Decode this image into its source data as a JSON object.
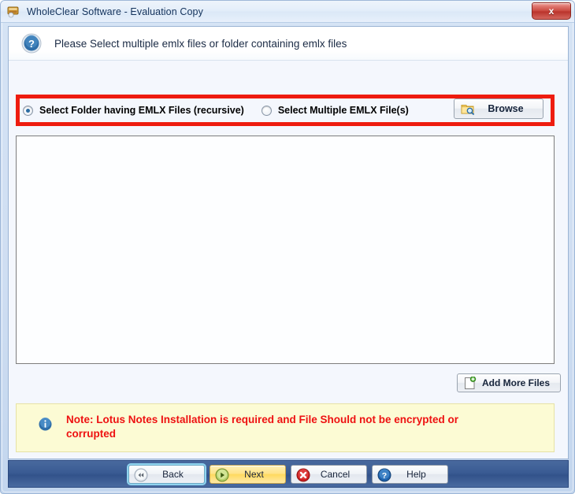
{
  "window": {
    "title": "WholeClear Software - Evaluation Copy",
    "app_icon": "app-icon",
    "close_label": "x"
  },
  "header": {
    "icon": "question-icon",
    "instruction": "Please Select multiple emlx files or folder containing emlx files"
  },
  "options": {
    "folder_option": {
      "label": "Select Folder having EMLX Files (recursive)",
      "selected": true
    },
    "files_option": {
      "label": "Select Multiple EMLX File(s)",
      "selected": false
    },
    "browse_button": {
      "label": "Browse",
      "icon": "folder-search-icon"
    }
  },
  "file_list": {
    "items": []
  },
  "add_more": {
    "label": "Add More Files",
    "icon": "file-add-icon"
  },
  "note": {
    "icon": "info-icon",
    "text": "Note: Lotus Notes Installation is required and File Should not be encrypted or corrupted",
    "color": "#ee1111",
    "background": "#fcfbd4"
  },
  "footer": {
    "buttons": [
      {
        "label": "Back",
        "icon": "rewind-icon",
        "state": "focused"
      },
      {
        "label": "Next",
        "icon": "play-icon",
        "state": "default"
      },
      {
        "label": "Cancel",
        "icon": "error-icon",
        "state": "normal"
      },
      {
        "label": "Help",
        "icon": "help-icon",
        "state": "normal"
      }
    ]
  },
  "annotation": {
    "highlight_color": "#ee1c0f"
  }
}
